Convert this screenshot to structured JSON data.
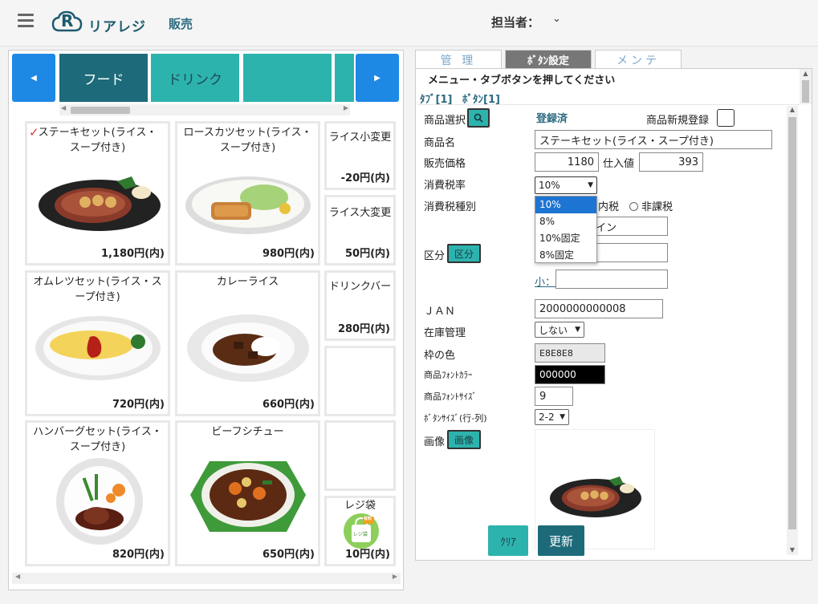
{
  "header": {
    "app_name": "リアレジ",
    "logo_letter": "R",
    "nav_sales": "販売",
    "staff_label": "担当者：",
    "staff_chev": "⌄"
  },
  "left": {
    "prev_arrow": "◀",
    "next_arrow": "▶",
    "tabs": [
      {
        "label": "フード"
      },
      {
        "label": "ドリンク"
      },
      {
        "label": ""
      },
      {
        "label": ""
      }
    ],
    "products": [
      {
        "name": "ステーキセット(ライス・スープ付き)",
        "price": "1,180円(内)",
        "checked": "✓"
      },
      {
        "name": "ロースカツセット(ライス・スープ付き)",
        "price": "980円(内)"
      },
      {
        "name": "ライス小変更",
        "price": "-20円(内)"
      },
      {
        "name": "ライス大変更",
        "price": "50円(内)"
      },
      {
        "name": "オムレツセット(ライス・スープ付き)",
        "price": "720円(内)"
      },
      {
        "name": "カレーライス",
        "price": "660円(内)"
      },
      {
        "name": "ドリンクバー",
        "price": "280円(内)"
      },
      {
        "name": "ハンバーグセット(ライス・スープ付き)",
        "price": "820円(内)"
      },
      {
        "name": "ビーフシチュー",
        "price": "650円(内)"
      },
      {
        "name": "レジ袋",
        "price": "10円(内)",
        "bag_text": "有料",
        "bag_sub": "レジ袋"
      }
    ]
  },
  "right": {
    "tabs": [
      "管 理",
      "ﾎﾞﾀﾝ設定",
      "メンテ"
    ],
    "instruction": "メニュー・タブボタンを押してください",
    "tab_info": "ﾀﾌﾞ[1]",
    "button_info": "ﾎﾞﾀﾝ[1]",
    "product_select_label": "商品選択",
    "registered": "登録済",
    "new_product_label": "商品新規登録",
    "product_name_label": "商品名",
    "product_name_value": "ステーキセット(ライス・スープ付き)",
    "price_label": "販売価格",
    "price_value": "1180",
    "cost_label": "仕入値",
    "cost_value": "393",
    "tax_rate_label": "消費税率",
    "tax_rate_value": "10%",
    "tax_rate_options": [
      "10%",
      "8%",
      "10%固定",
      "8%固定"
    ],
    "tax_type_label": "消費税種別",
    "tax_inclusive": "内税",
    "tax_exempt": "非課税",
    "category_field1": "イン",
    "category_label": "区分",
    "category_button": "区分",
    "small_label": "小：",
    "jan_label": "ＪＡＮ",
    "jan_value": "2000000000008",
    "stock_label": "在庫管理",
    "stock_value": "しない",
    "frame_color_label": "枠の色",
    "frame_color_value": "E8E8E8",
    "font_color_label": "商品ﾌｫﾝﾄｶﾗｰ",
    "font_color_value": "000000",
    "font_size_label": "商品ﾌｫﾝﾄｻｲｽﾞ",
    "font_size_value": "9",
    "button_size_label": "ﾎﾞﾀﾝｻｲｽﾞ(行-列)",
    "button_size_value": "2-2",
    "image_label": "画像",
    "image_button": "画像",
    "clear_button": "ｸﾘｱ",
    "update_button": "更新"
  },
  "colors": {
    "teal": "#2db3ad",
    "dark_teal": "#1d6b7a",
    "blue": "#1e88e5",
    "accent_red": "#e53935"
  }
}
